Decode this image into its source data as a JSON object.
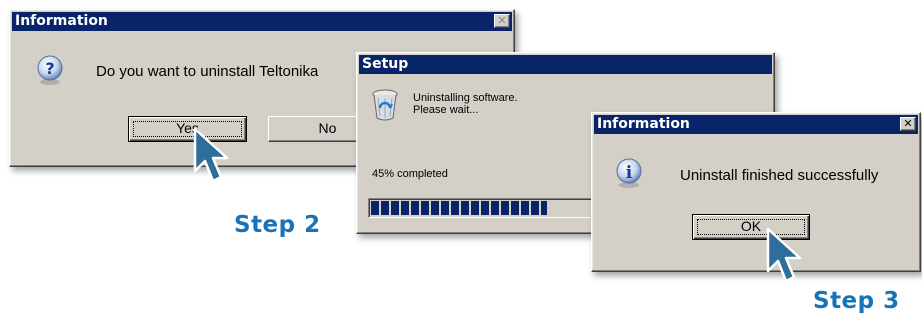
{
  "dialog1": {
    "title": "Information",
    "message": "Do you want to uninstall Teltonika",
    "yes_label": "Yes",
    "no_label": "No",
    "icon": "question-icon"
  },
  "dialog2": {
    "title": "Setup",
    "line1": "Uninstalling software.",
    "line2": "Please wait...",
    "progress_text": "45% completed",
    "progress_fraction": 0.45,
    "icon": "recycle-bin-icon"
  },
  "dialog3": {
    "title": "Information",
    "message": "Uninstall finished successfully",
    "ok_label": "OK",
    "icon": "info-icon"
  },
  "steps": {
    "step2": "Step 2",
    "step3": "Step 3"
  },
  "colors": {
    "titlebar": "#0a246a",
    "step_text": "#1874b6",
    "progress": "#0a246a",
    "cursor": "#2e6e9c"
  }
}
